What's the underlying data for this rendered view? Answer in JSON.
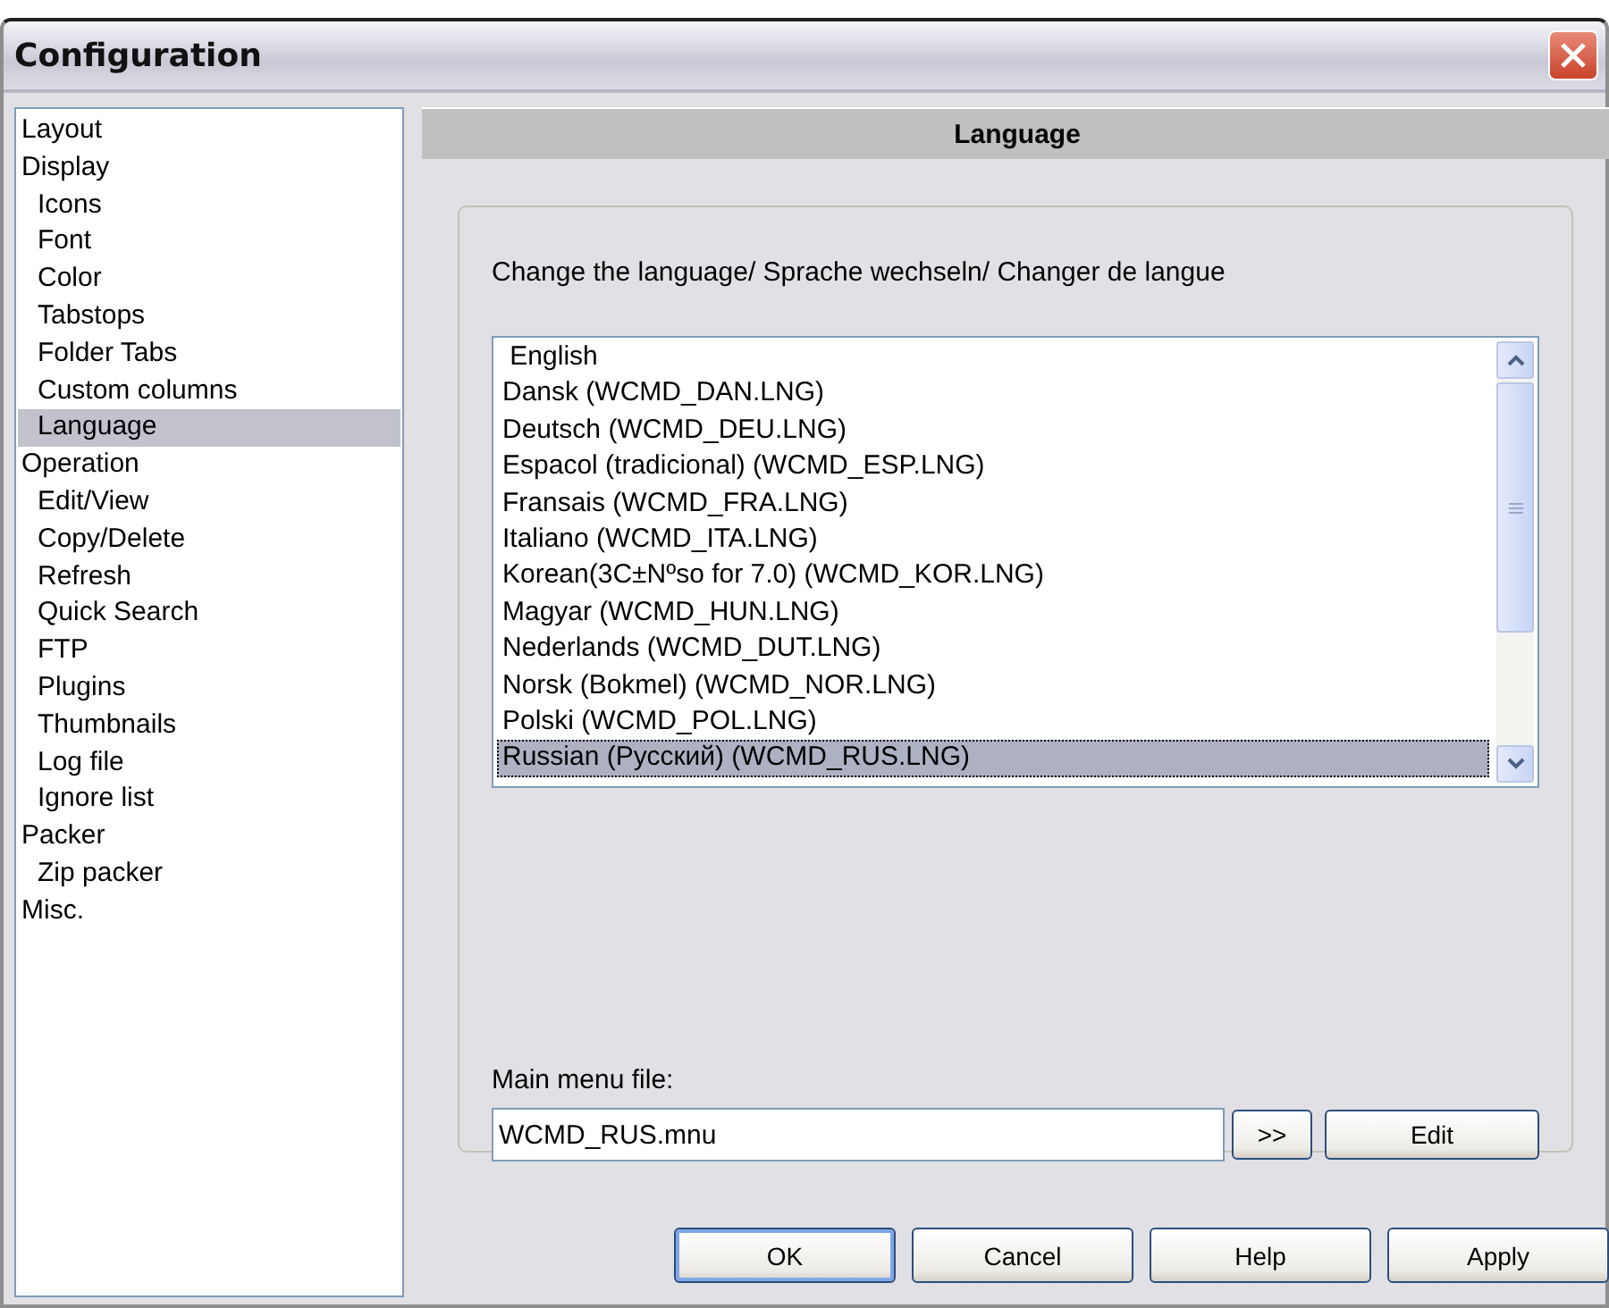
{
  "window": {
    "title": "Configuration"
  },
  "sidebar": {
    "items": [
      {
        "label": "Layout",
        "selected": false
      },
      {
        "label": "Display",
        "selected": false,
        "children": [
          {
            "label": "Icons",
            "selected": false
          },
          {
            "label": "Font",
            "selected": false
          },
          {
            "label": "Color",
            "selected": false
          },
          {
            "label": "Tabstops",
            "selected": false
          },
          {
            "label": "Folder Tabs",
            "selected": false
          },
          {
            "label": "Custom columns",
            "selected": false
          },
          {
            "label": "Language",
            "selected": true
          }
        ]
      },
      {
        "label": "Operation",
        "selected": false,
        "children": [
          {
            "label": "Edit/View",
            "selected": false
          },
          {
            "label": "Copy/Delete",
            "selected": false
          },
          {
            "label": "Refresh",
            "selected": false
          },
          {
            "label": "Quick Search",
            "selected": false
          },
          {
            "label": "FTP",
            "selected": false
          },
          {
            "label": "Plugins",
            "selected": false
          },
          {
            "label": "Thumbnails",
            "selected": false
          },
          {
            "label": "Log file",
            "selected": false
          },
          {
            "label": "Ignore list",
            "selected": false
          }
        ]
      },
      {
        "label": "Packer",
        "selected": false,
        "children": [
          {
            "label": "Zip packer",
            "selected": false
          }
        ]
      },
      {
        "label": "Misc.",
        "selected": false
      }
    ]
  },
  "panel": {
    "title": "Language",
    "language_label": "Change the language/ Sprache wechseln/ Changer de langue",
    "languages": [
      {
        "label": " English",
        "selected": false
      },
      {
        "label": "Dansk (WCMD_DAN.LNG)",
        "selected": false
      },
      {
        "label": "Deutsch (WCMD_DEU.LNG)",
        "selected": false
      },
      {
        "label": "Espacol (tradicional) (WCMD_ESP.LNG)",
        "selected": false
      },
      {
        "label": "Fransais (WCMD_FRA.LNG)",
        "selected": false
      },
      {
        "label": "Italiano (WCMD_ITA.LNG)",
        "selected": false
      },
      {
        "label": "Korean(3C±Nºso for 7.0) (WCMD_KOR.LNG)",
        "selected": false
      },
      {
        "label": "Magyar (WCMD_HUN.LNG)",
        "selected": false
      },
      {
        "label": "Nederlands (WCMD_DUT.LNG)",
        "selected": false
      },
      {
        "label": "Norsk (Bokmel) (WCMD_NOR.LNG)",
        "selected": false
      },
      {
        "label": "Polski (WCMD_POL.LNG)",
        "selected": false
      },
      {
        "label": "Russian (Русский) (WCMD_RUS.LNG)",
        "selected": true
      }
    ],
    "menu_file_label": "Main menu file:",
    "menu_file": {
      "value": "WCMD_RUS.mnu"
    },
    "browse_button": ">>",
    "edit_button": "Edit"
  },
  "buttons": [
    {
      "label": "OK",
      "default": true
    },
    {
      "label": "Cancel",
      "default": false
    },
    {
      "label": "Help",
      "default": false
    },
    {
      "label": "Apply",
      "default": false
    }
  ]
}
